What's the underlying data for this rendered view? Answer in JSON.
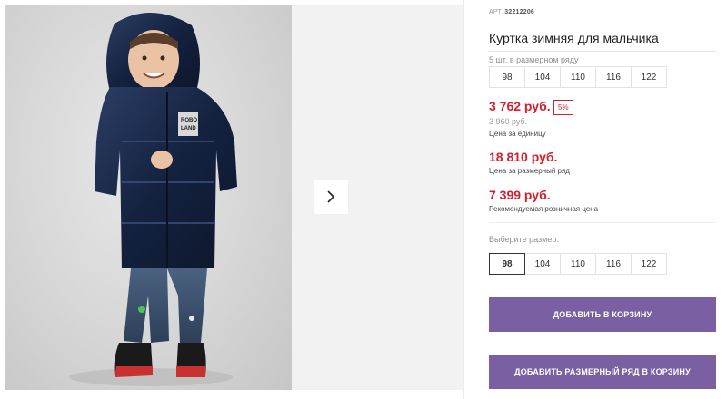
{
  "product": {
    "article_label": "АРТ.",
    "article_number": "32212206",
    "title": "Куртка зимняя для мальчика",
    "set_label": "5 шт. в размерном ряду",
    "set_sizes": [
      "98",
      "104",
      "110",
      "116",
      "122"
    ],
    "unit_price": "3 762 руб.",
    "discount_badge": "5%",
    "old_price": "3 960 руб.",
    "unit_price_caption": "Цена за единицу",
    "set_price": "18 810 руб.",
    "set_price_caption": "Цена за размерный ряд",
    "retail_price": "7 399 руб.",
    "retail_price_caption": "Рекомендуемая розничная цена",
    "choose_size_label": "Выберите размер:",
    "size_options": [
      "98",
      "104",
      "110",
      "116",
      "122"
    ],
    "selected_size": "98",
    "add_to_cart_label": "ДОБАВИТЬ В КОРЗИНУ",
    "add_set_to_cart_label": "ДОБАВИТЬ РАЗМЕРНЫЙ РЯД В КОРЗИНУ"
  },
  "gallery": {
    "next_icon": "chevron-right-icon"
  },
  "colors": {
    "price_red": "#d2202f",
    "button_purple": "#7b5fa3"
  }
}
